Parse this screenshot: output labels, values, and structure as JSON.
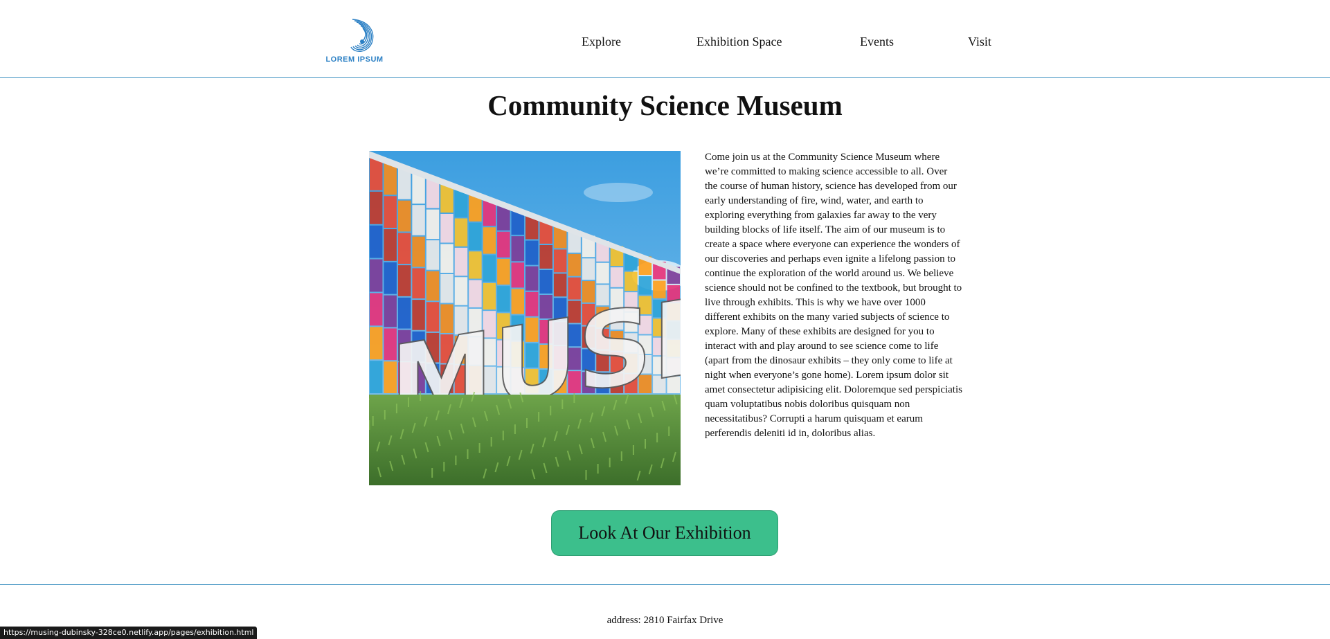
{
  "header": {
    "logo_text": "LOREM IPSUM",
    "logo_icon": "spiral-shell-icon",
    "nav": [
      {
        "label": "Explore"
      },
      {
        "label": "Exhibition Space"
      },
      {
        "label": "Events"
      },
      {
        "label": "Visit"
      }
    ]
  },
  "main": {
    "title": "Community Science Museum",
    "image_subject": "colorful glass facade with MUSEUM letters",
    "description": "Come join us at the Community Science Museum where we’re committed to making science accessible to all. Over the course of human history, science has developed from our early understanding of fire, wind, water, and earth to exploring everything from galaxies far away to the very building blocks of life itself. The aim of our museum is to create a space where everyone can experience the wonders of our discoveries and perhaps even ignite a lifelong passion to continue the exploration of the world around us. We believe science should not be confined to the textbook, but brought to live through exhibits. This is why we have over 1000 different exhibits on the many varied subjects of science to explore. Many of these exhibits are designed for you to interact with and play around to see science come to life (apart from the dinosaur exhibits – they only come to life at night when everyone’s gone home). Lorem ipsum dolor sit amet consectetur adipisicing elit. Doloremque sed perspiciatis quam voluptatibus nobis doloribus quisquam non necessitatibus? Corrupti a harum quisquam et earum perferendis deleniti id in, doloribus alias.",
    "cta_label": "Look At Our Exhibition"
  },
  "footer": {
    "address": "address: 2810 Fairfax Drive"
  },
  "status_bar": {
    "url": "https://musing-dubinsky-328ce0.netlify.app/pages/exhibition.html"
  },
  "colors": {
    "accent_line": "#3a8fc0",
    "cta_background": "#3cbf8c",
    "logo_blue": "#2a7fc4"
  }
}
